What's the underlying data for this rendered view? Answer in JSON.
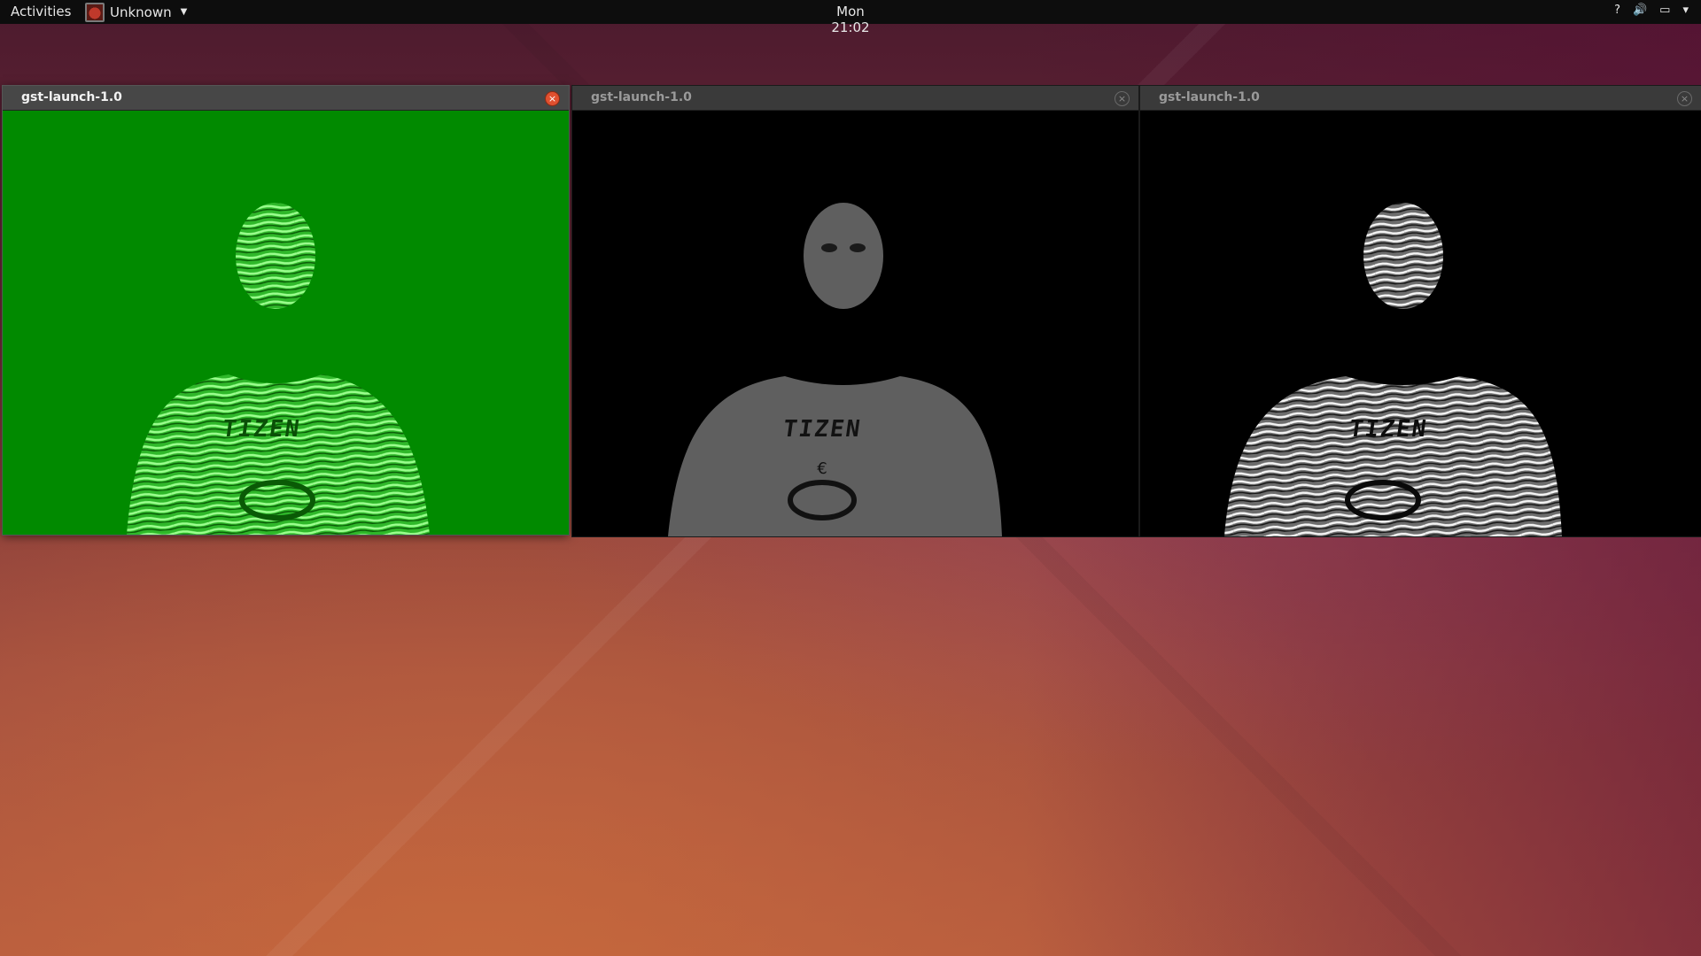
{
  "top_panel": {
    "activities_label": "Activities",
    "app_menu_label": "Unknown",
    "clock": "Mon 21:02",
    "tray_icons": [
      "help-icon",
      "volume-icon",
      "battery-icon",
      "system-menu-chevron-icon"
    ],
    "tray_help_glyph": "?",
    "tray_volume_glyph": "🔊",
    "tray_battery_glyph": "▭",
    "tray_caret_glyph": "▾"
  },
  "windows": [
    {
      "title": "gst-launch-1.0",
      "state": "active",
      "content": "video-feed-green-depth",
      "shirt_text": "TIZEN"
    },
    {
      "title": "gst-launch-1.0",
      "state": "inactive",
      "content": "video-feed-grayscale-depth",
      "shirt_text": "TIZEN"
    },
    {
      "title": "gst-launch-1.0",
      "state": "inactive",
      "content": "video-feed-monochrome-depth",
      "shirt_text": "TIZEN"
    }
  ],
  "colors": {
    "panel_bg": "#0d0d0d",
    "close_active": "#e0502f",
    "green_feed_bg": "#018a00",
    "green_figure": "#3ed13a",
    "gray_figure": "#5f5f5f",
    "white_figure": "#d8d8d8"
  },
  "close_glyph": "×"
}
